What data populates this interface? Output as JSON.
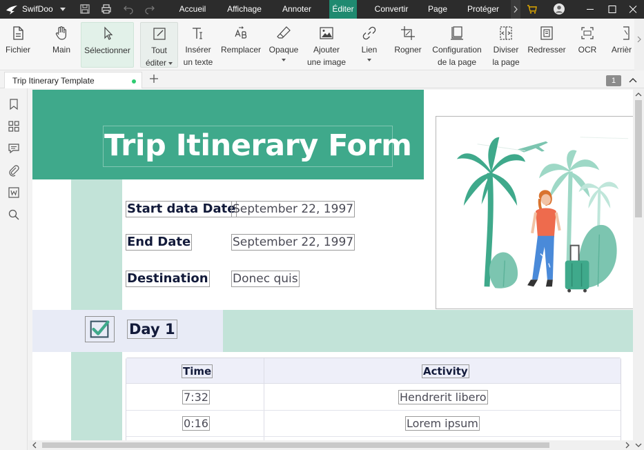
{
  "app": {
    "name": "SwifDoo"
  },
  "menu": {
    "items": [
      {
        "label": "Accueil",
        "active": false
      },
      {
        "label": "Affichage",
        "active": false
      },
      {
        "label": "Annoter",
        "active": false
      },
      {
        "label": "Éditer",
        "active": true
      },
      {
        "label": "Convertir",
        "active": false
      },
      {
        "label": "Page",
        "active": false
      },
      {
        "label": "Protéger",
        "active": false
      }
    ]
  },
  "ribbon": {
    "fichier": {
      "label": "Fichier",
      "icon": "file-icon"
    },
    "main": {
      "label": "Main",
      "icon": "hand-icon"
    },
    "selectionner": {
      "label": "Sélectionner",
      "icon": "cursor-icon"
    },
    "tout_editer": {
      "line1": "Tout",
      "line2": "éditer",
      "icon": "edit-icon"
    },
    "inserer_texte": {
      "line1": "Insérer",
      "line2": "un texte",
      "icon": "text-icon"
    },
    "remplacer": {
      "label": "Remplacer",
      "icon": "replace-icon"
    },
    "opaque": {
      "label": "Opaque",
      "icon": "eraser-icon"
    },
    "ajouter_image": {
      "line1": "Ajouter",
      "line2": "une image",
      "icon": "image-icon"
    },
    "lien": {
      "label": "Lien",
      "icon": "link-icon"
    },
    "rogner": {
      "label": "Rogner",
      "icon": "crop-icon"
    },
    "configuration": {
      "line1": "Configuration",
      "line2": "de la page",
      "icon": "page-setup-icon"
    },
    "diviser": {
      "line1": "Diviser",
      "line2": "la page",
      "icon": "split-icon"
    },
    "redresser": {
      "label": "Redresser",
      "icon": "deskew-icon"
    },
    "ocr": {
      "label": "OCR",
      "icon": "ocr-icon"
    },
    "arriere": {
      "label": "Arrièr",
      "icon": "background-icon"
    }
  },
  "tabs": {
    "document": "Trip Itinerary Template",
    "page_number": "1"
  },
  "document": {
    "title": "Trip Itinerary Form",
    "fields": [
      {
        "label": "Start data Date",
        "value": "September 22, 1997"
      },
      {
        "label": "End Date",
        "value": "September 22, 1997"
      },
      {
        "label": "Destination",
        "value": "Donec quis"
      }
    ],
    "day_label": "Day 1",
    "schedule": {
      "headers": [
        "Time",
        "Activity"
      ],
      "rows": [
        {
          "time": "7:32",
          "activity": "Hendrerit libero"
        },
        {
          "time": "0:16",
          "activity": "Lorem ipsum"
        }
      ]
    }
  },
  "colors": {
    "brand_green": "#3fa98b",
    "light_green": "#c2e3d8",
    "band_lavender": "#e8ebf6",
    "titlebar": "#2c2c2c",
    "active_menu": "#1f8a70"
  }
}
